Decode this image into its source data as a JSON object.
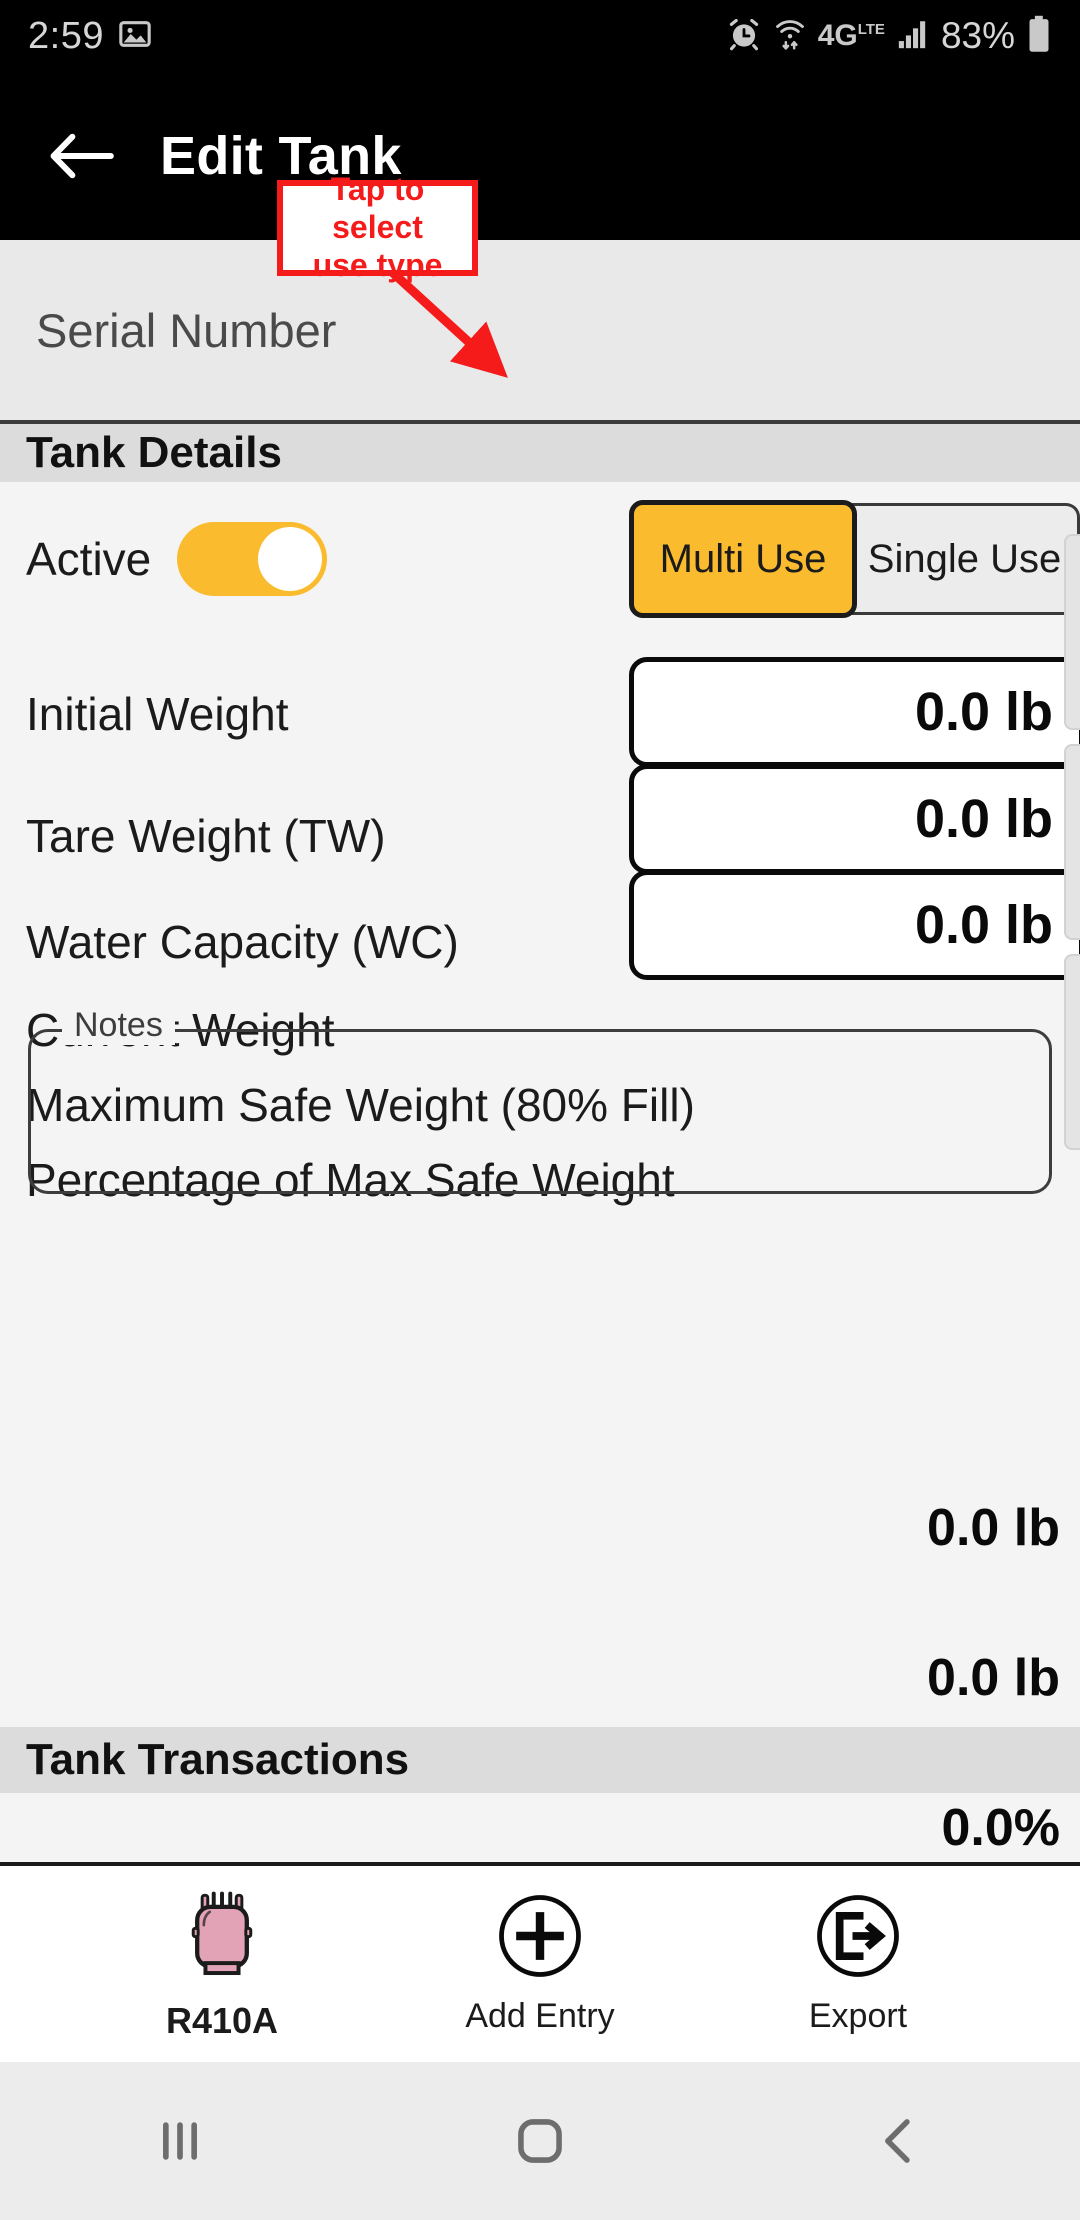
{
  "status_bar": {
    "time": "2:59",
    "network_label": "4G",
    "network_sub": "LTE",
    "battery_percent": "83%",
    "icons": [
      "image-icon",
      "alarm-icon",
      "wifi-icon",
      "network-4glte-icon",
      "signal-bars-icon",
      "battery-icon"
    ]
  },
  "app_bar": {
    "title": "Edit Tank",
    "back_icon": "back-arrow-icon"
  },
  "serial": {
    "label": "Serial Number",
    "value": ""
  },
  "annotation": {
    "line1": "Tap to select",
    "line2": "use type",
    "color": "#f51b1b"
  },
  "sections": {
    "details_title": "Tank Details",
    "transactions_title": "Tank Transactions"
  },
  "accent_color": "#fabb2e",
  "active_row": {
    "label": "Active",
    "enabled": true
  },
  "use_type": {
    "options": [
      "Multi Use",
      "Single Use"
    ],
    "selected": "Multi Use"
  },
  "fields": [
    {
      "label": "Initial Weight",
      "value": "0.0 lb",
      "editable": true
    },
    {
      "label": "Tare Weight (TW)",
      "value": "0.0 lb",
      "editable": true
    },
    {
      "label": "Water Capacity (WC)",
      "value": "0.0 lb",
      "editable": true
    }
  ],
  "readonly_fields": [
    {
      "label": "Current Weight",
      "value": "0.0 lb"
    },
    {
      "label": "Maximum Safe Weight (80% Fill)",
      "value": "0.0 lb"
    },
    {
      "label": "Percentage of Max Safe Weight",
      "value": "0.0%"
    }
  ],
  "notes": {
    "legend": "Notes",
    "value": "",
    "placeholder": ""
  },
  "actions": [
    {
      "label": "R410A",
      "icon": "refrigerant-tank-icon",
      "color": "#e3a3b6"
    },
    {
      "label": "Add Entry",
      "icon": "plus-circle-icon"
    },
    {
      "label": "Export",
      "icon": "export-circle-icon"
    }
  ],
  "nav_bar": {
    "recents": "recents-icon",
    "home": "home-icon",
    "back": "back-chevron-icon"
  }
}
